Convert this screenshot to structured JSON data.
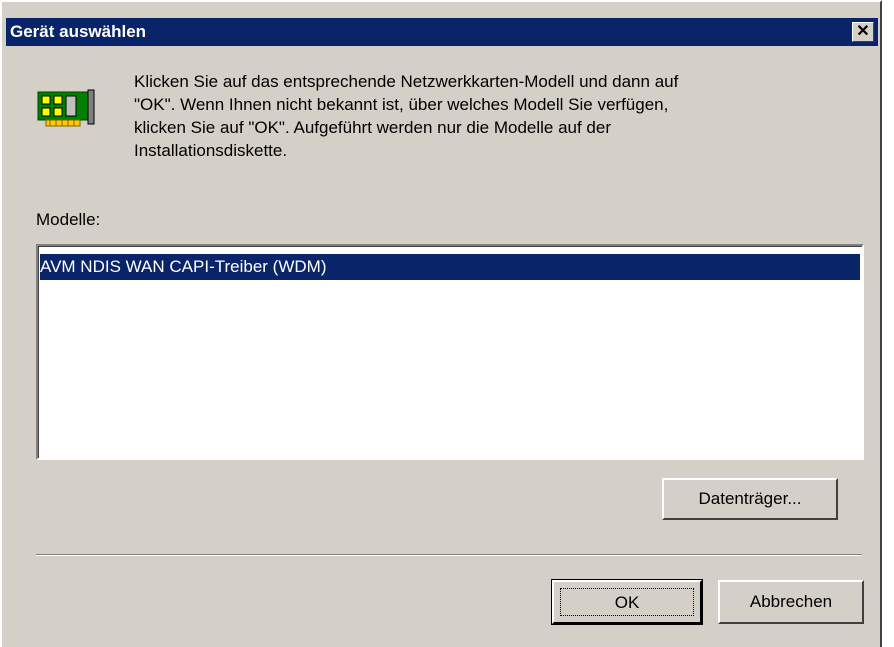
{
  "window": {
    "title": "Gerät auswählen",
    "close_glyph": "✕"
  },
  "intro": {
    "icon": "network-card-icon",
    "lines": [
      "Klicken Sie auf das entsprechende Netzwerkkarten-Modell und dann auf",
      "\"OK\". Wenn Ihnen nicht bekannt ist, über welches Modell Sie verfügen,",
      "klicken Sie auf \"OK\".  Aufgeführt werden nur die Modelle auf der",
      "Installationsdiskette."
    ]
  },
  "models": {
    "label": "Modelle:",
    "items": [
      {
        "label": "AVM NDIS WAN CAPI-Treiber (WDM)",
        "selected": true
      }
    ]
  },
  "buttons": {
    "disk": "Datenträger...",
    "ok": "OK",
    "cancel": "Abbrechen"
  },
  "colors": {
    "titlebar": "#0a246a",
    "face": "#d4d0c8",
    "selection": "#0a246a"
  }
}
